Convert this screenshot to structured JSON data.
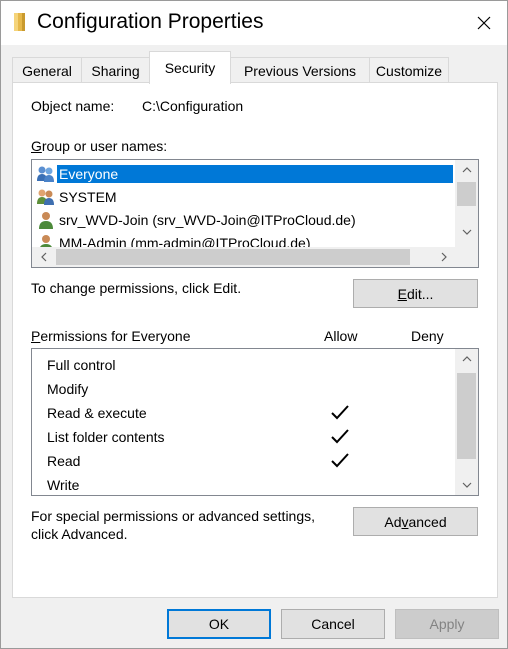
{
  "window": {
    "title": "Configuration Properties",
    "title_icon": "folder-icon",
    "close_icon": "close-icon"
  },
  "tabs": [
    {
      "label": "General",
      "active": false
    },
    {
      "label": "Sharing",
      "active": false
    },
    {
      "label": "Security",
      "active": true
    },
    {
      "label": "Previous Versions",
      "active": false
    },
    {
      "label": "Customize",
      "active": false
    }
  ],
  "security": {
    "object_name_label": "Object name:",
    "object_name_value": "C:\\Configuration",
    "groups_label": "Group or user names:",
    "groups": [
      {
        "name": "Everyone",
        "icon": "users-group-icon",
        "selected": true
      },
      {
        "name": "SYSTEM",
        "icon": "users-group-icon",
        "selected": false
      },
      {
        "name": "srv_WVD-Join (srv_WVD-Join@ITProCloud.de)",
        "icon": "user-icon",
        "selected": false
      },
      {
        "name": "MM-Admin (mm-admin@ITProCloud.de)",
        "icon": "user-icon",
        "selected": false
      }
    ],
    "change_text": "To change permissions, click Edit.",
    "edit_button": "Edit...",
    "permissions_label": "Permissions for Everyone",
    "allow_header": "Allow",
    "deny_header": "Deny",
    "permissions": [
      {
        "name": "Full control",
        "allow": false,
        "deny": false
      },
      {
        "name": "Modify",
        "allow": false,
        "deny": false
      },
      {
        "name": "Read & execute",
        "allow": true,
        "deny": false
      },
      {
        "name": "List folder contents",
        "allow": true,
        "deny": false
      },
      {
        "name": "Read",
        "allow": true,
        "deny": false
      },
      {
        "name": "Write",
        "allow": false,
        "deny": false
      }
    ],
    "special_text_line1": "For special permissions or advanced settings,",
    "special_text_line2": "click Advanced.",
    "advanced_button": "Advanced"
  },
  "footer": {
    "ok": "OK",
    "cancel": "Cancel",
    "apply": "Apply"
  },
  "colors": {
    "selection": "#0078d7",
    "default_button_border": "#0078d7"
  }
}
